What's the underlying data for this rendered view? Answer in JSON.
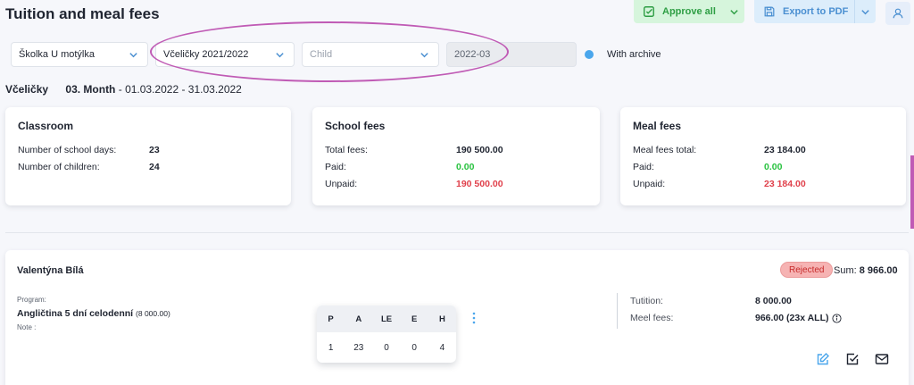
{
  "header": {
    "title": "Tuition and meal fees",
    "approve_label": "Approve all",
    "export_label": "Export to PDF"
  },
  "filters": {
    "school": "Školka U motýlka",
    "class": "Včeličky 2021/2022",
    "child_placeholder": "Child",
    "month": "2022-03",
    "archive_label": "With archive"
  },
  "subheading": {
    "class_name": "Včeličky",
    "month_label": "03. Month",
    "range": "- 01.03.2022 - 31.03.2022"
  },
  "cards": {
    "classroom": {
      "title": "Classroom",
      "school_days_label": "Number of school days:",
      "school_days": "23",
      "children_label": "Number of children:",
      "children": "24"
    },
    "school_fees": {
      "title": "School fees",
      "total_label": "Total fees:",
      "total": "190 500.00",
      "paid_label": "Paid:",
      "paid": "0.00",
      "unpaid_label": "Unpaid:",
      "unpaid": "190 500.00"
    },
    "meal_fees": {
      "title": "Meal fees",
      "total_label": "Meal fees total:",
      "total": "23 184.00",
      "paid_label": "Paid:",
      "paid": "0.00",
      "unpaid_label": "Unpaid:",
      "unpaid": "23 184.00"
    }
  },
  "child": {
    "name": "Valentýna Bílá",
    "status": "Rejected",
    "sum_label": "Sum:",
    "sum": "8 966.00",
    "program_label": "Program:",
    "program_name": "Angličtina 5 dní celodenní",
    "program_amount": "(8 000.00)",
    "note_label": "Note :",
    "attendance": {
      "headers": [
        "P",
        "A",
        "LE",
        "E",
        "H"
      ],
      "values": [
        "1",
        "23",
        "0",
        "0",
        "4"
      ]
    },
    "tuition_label": "Tutition:",
    "tuition": "8 000.00",
    "meal_label": "Meel fees:",
    "meal": "966.00 (23x ALL)"
  },
  "colors": {
    "approve_bg": "#d6f5dc",
    "approve_text": "#2e9e44",
    "export_bg": "#dcedfb",
    "export_text": "#4a8fd1",
    "paid_green": "#28c23f",
    "unpaid_red": "#e0404b",
    "rejected_bg": "#f6b3b3",
    "highlight": "#c05bb5"
  },
  "icons": {
    "approve": "check-square-icon",
    "export": "save-icon",
    "user": "user-icon",
    "dropdown": "chevron-down-icon",
    "info": "info-icon",
    "kebab": "kebab-icon",
    "edit": "edit-icon",
    "approve_row": "check-square-icon",
    "mail": "mail-icon"
  }
}
